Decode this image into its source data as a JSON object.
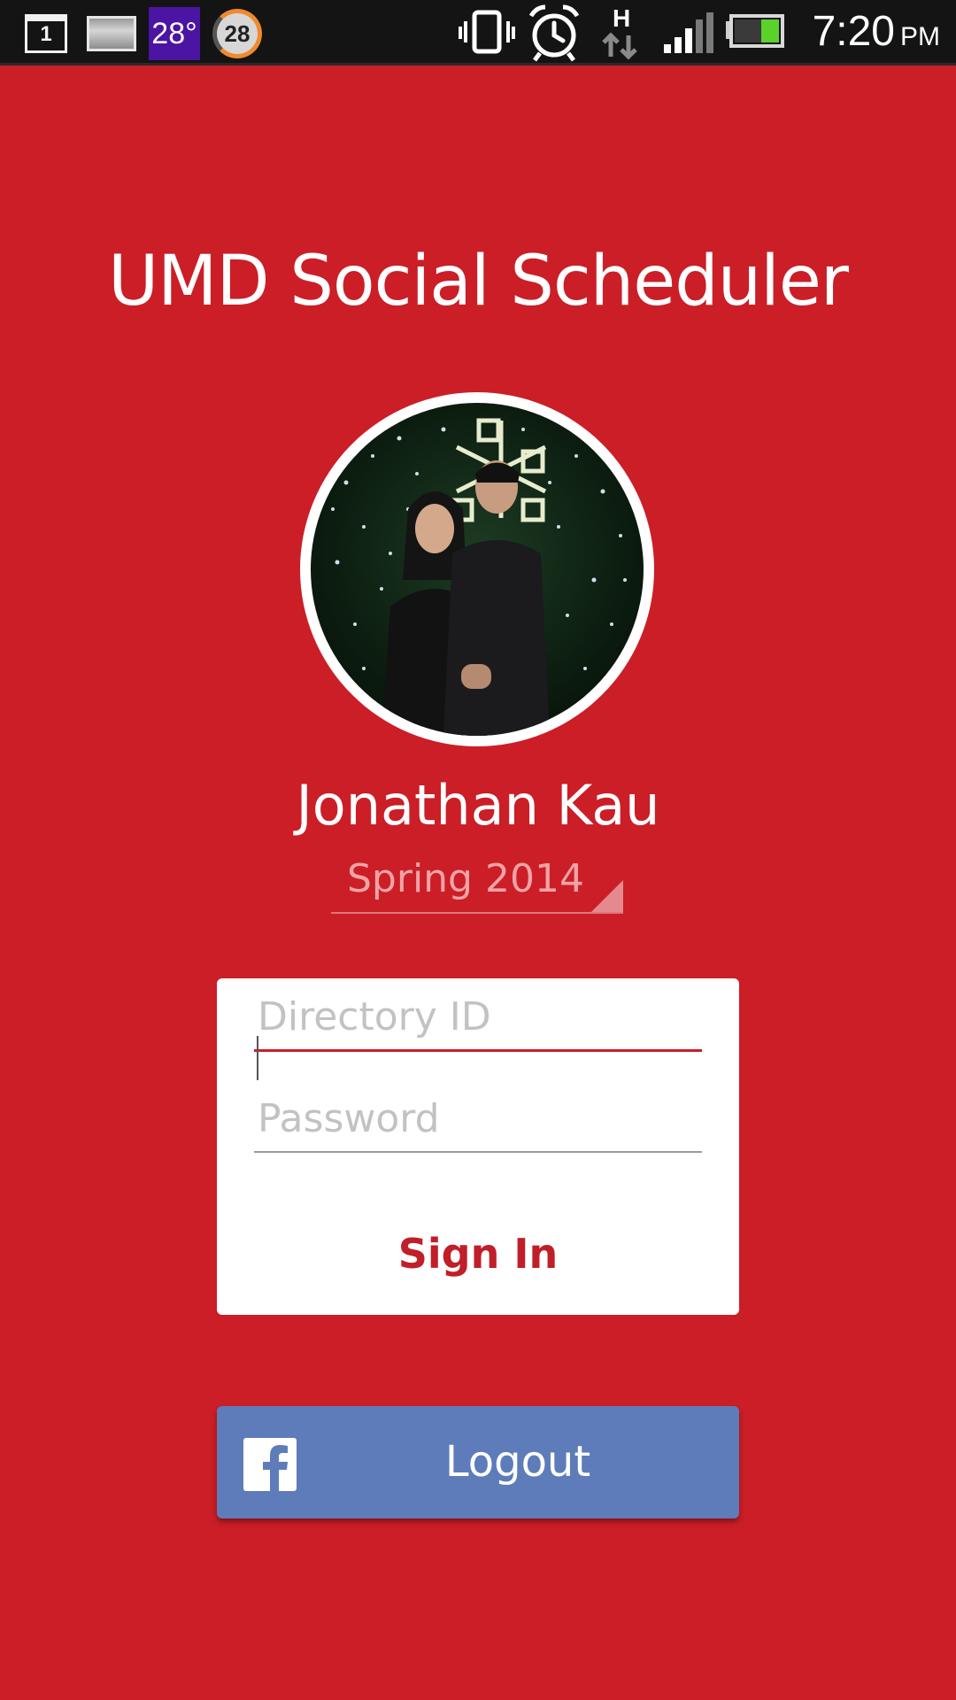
{
  "status_bar": {
    "calendar_day": "1",
    "temperature": "28°",
    "round_badge": "28",
    "time": "7:20",
    "ampm": "PM",
    "network_type": "H",
    "icons": [
      "calendar-icon",
      "gallery-icon",
      "weather-icon",
      "sync-icon",
      "vibrate-icon",
      "alarm-icon",
      "data-arrows-icon",
      "signal-icon",
      "battery-icon"
    ]
  },
  "app": {
    "title": "UMD Social Scheduler"
  },
  "profile": {
    "name": "Jonathan Kau",
    "term": "Spring 2014"
  },
  "login": {
    "directory_placeholder": "Directory ID",
    "directory_value": "",
    "password_placeholder": "Password",
    "password_value": "",
    "signin_label": "Sign In"
  },
  "facebook": {
    "label": "Logout",
    "icon": "facebook-icon"
  },
  "colors": {
    "background": "#cb1e27",
    "accent_red": "#c01e28",
    "facebook_blue": "#5e7cba",
    "status_bar": "#141414"
  }
}
